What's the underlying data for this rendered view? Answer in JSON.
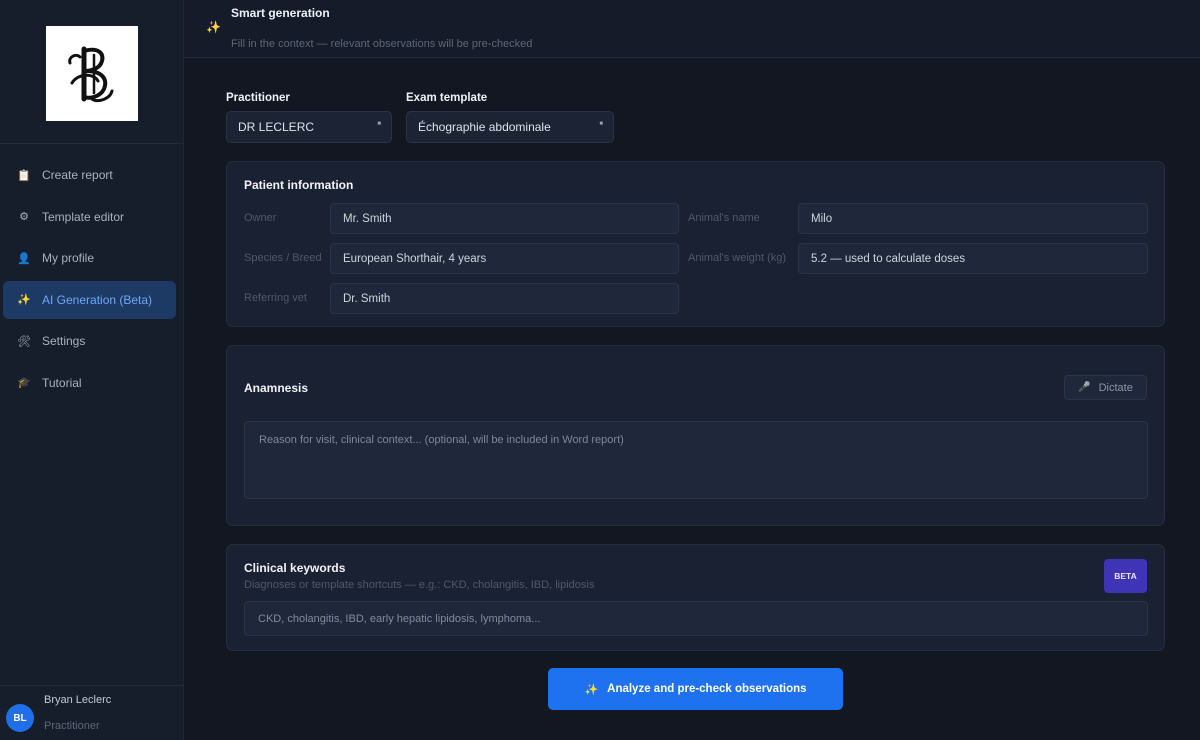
{
  "sidebar": {
    "logo_alt": "logo",
    "items": [
      {
        "label": "Create report",
        "icon": "clipboard-icon",
        "glyph": "📋"
      },
      {
        "label": "Template editor",
        "icon": "gear-icon",
        "glyph": "⚙"
      },
      {
        "label": "My profile",
        "icon": "person-icon",
        "glyph": "👤"
      },
      {
        "label": "AI Generation (Beta)",
        "icon": "sparkles-icon",
        "glyph": "✨",
        "active": true
      },
      {
        "label": "Settings",
        "icon": "tools-icon",
        "glyph": "🛠"
      },
      {
        "label": "Tutorial",
        "icon": "graduation-cap-icon",
        "glyph": "🎓"
      }
    ],
    "user": {
      "initials": "BL",
      "name": "Bryan Leclerc",
      "role": "Practitioner"
    }
  },
  "header": {
    "title": "Smart generation",
    "subtitle": "Fill in the context — relevant observations will be pre-checked"
  },
  "selectors": {
    "practitioner_label": "Practitioner",
    "practitioner_value": "DR LECLERC",
    "template_label": "Exam template",
    "template_value": "Échographie abdominale"
  },
  "patient": {
    "title": "Patient information",
    "owner_label": "Owner",
    "owner_value": "Mr. Smith",
    "animal_name_label": "Animal's name",
    "animal_name_value": "Milo",
    "species_label": "Species / Breed",
    "species_value": "European Shorthair, 4 years",
    "weight_label": "Animal's weight (kg)",
    "weight_value": "5.2  — used to calculate doses",
    "vet_label": "Referring vet",
    "vet_value": "Dr. Smith"
  },
  "anamnesis": {
    "title": "Anamnesis",
    "dictate_label": "Dictate",
    "placeholder": "Reason for visit, clinical context... (optional, will be included in Word report)"
  },
  "keywords": {
    "title": "Clinical keywords",
    "description": "Diagnoses or template shortcuts — e.g.: CKD, cholangitis, IBD, lipidosis",
    "badge": "BETA",
    "placeholder": "CKD, cholangitis, IBD, early hepatic lipidosis, lymphoma..."
  },
  "actions": {
    "analyze_label": "Analyze and pre-check observations"
  },
  "colors": {
    "accent": "#1e72f0",
    "active_nav_bg": "#1d3a64",
    "beta_badge": "#3e34b5"
  }
}
